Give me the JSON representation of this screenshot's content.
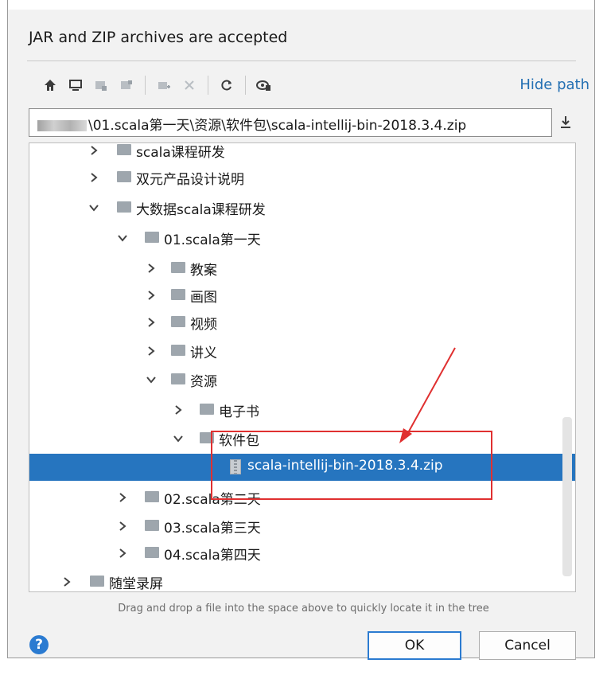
{
  "dialog": {
    "header": "JAR and ZIP archives are accepted",
    "hide_path_label": "Hide path",
    "path_value": "\\01.scala第一天\\资源\\软件包\\scala-intellij-bin-2018.3.4.zip",
    "hint": "Drag and drop a file into the space above to quickly locate it in the tree",
    "ok_label": "OK",
    "cancel_label": "Cancel",
    "help_label": "?"
  },
  "toolbar": {
    "icons": [
      "home-icon",
      "desktop-icon",
      "project-icon",
      "module-icon",
      "new-folder-icon",
      "delete-icon",
      "refresh-icon",
      "show-hidden-icon"
    ]
  },
  "tree": {
    "rows": [
      {
        "label": "scala课程研发",
        "expanded": false
      },
      {
        "label": "双元产品设计说明",
        "expanded": false
      },
      {
        "label": "大数据scala课程研发",
        "expanded": true
      },
      {
        "label": "01.scala第一天",
        "expanded": true
      },
      {
        "label": "教案",
        "expanded": false
      },
      {
        "label": "画图",
        "expanded": false
      },
      {
        "label": "视频",
        "expanded": false
      },
      {
        "label": "讲义",
        "expanded": false
      },
      {
        "label": "资源",
        "expanded": true
      },
      {
        "label": "电子书",
        "expanded": false
      },
      {
        "label": "软件包",
        "expanded": true
      },
      {
        "label": "scala-intellij-bin-2018.3.4.zip",
        "selected": true
      },
      {
        "label": "02.scala第二天",
        "expanded": false
      },
      {
        "label": "03.scala第三天",
        "expanded": false
      },
      {
        "label": "04.scala第四天",
        "expanded": false
      },
      {
        "label": "随堂录屏",
        "expanded": false
      }
    ]
  },
  "colors": {
    "selection": "#2675bf",
    "link": "#2470b3",
    "annotation": "#e03030"
  }
}
